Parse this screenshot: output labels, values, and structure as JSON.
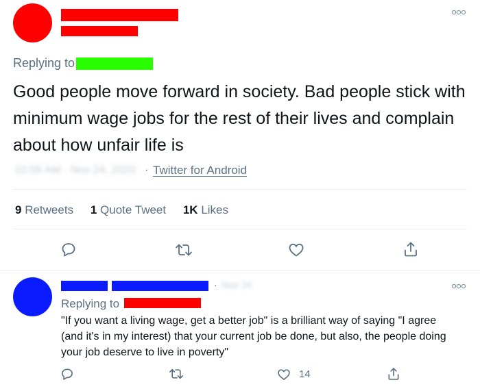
{
  "main_tweet": {
    "replying_to_label": "Replying to",
    "text": "Good people move forward in society. Bad people stick with minimum wage jobs for the rest of their lives and complain about how unfair life is",
    "timestamp": "10:09 AM · Nov 24, 2020",
    "separator": "·",
    "source": "Twitter for Android",
    "stats": {
      "retweets_count": "9",
      "retweets_label": "Retweets",
      "quotes_count": "1",
      "quotes_label": "Quote Tweet",
      "likes_count": "1K",
      "likes_label": "Likes"
    },
    "actions": [
      "reply-icon",
      "retweet-icon",
      "like-icon",
      "share-icon"
    ]
  },
  "reply_tweet": {
    "separator": "·",
    "date": "Nov 24",
    "replying_to_label": "Replying to",
    "text": "\"If you want a living wage, get a better job\" is a brilliant way of saying \"I agree (and it's in my interest) that your current job be done, but also, the people doing your job deserve to live in poverty\"",
    "like_count": "14",
    "actions": [
      "reply-icon",
      "retweet-icon",
      "like-icon",
      "share-icon"
    ]
  },
  "colors": {
    "redaction_red": "#ff0000",
    "redaction_green": "#29ff00",
    "redaction_blue": "#0a1cff",
    "text_primary": "#0f1419",
    "text_muted": "#5b7083",
    "icon": "#5b7083",
    "divider": "#e6ecf0"
  }
}
